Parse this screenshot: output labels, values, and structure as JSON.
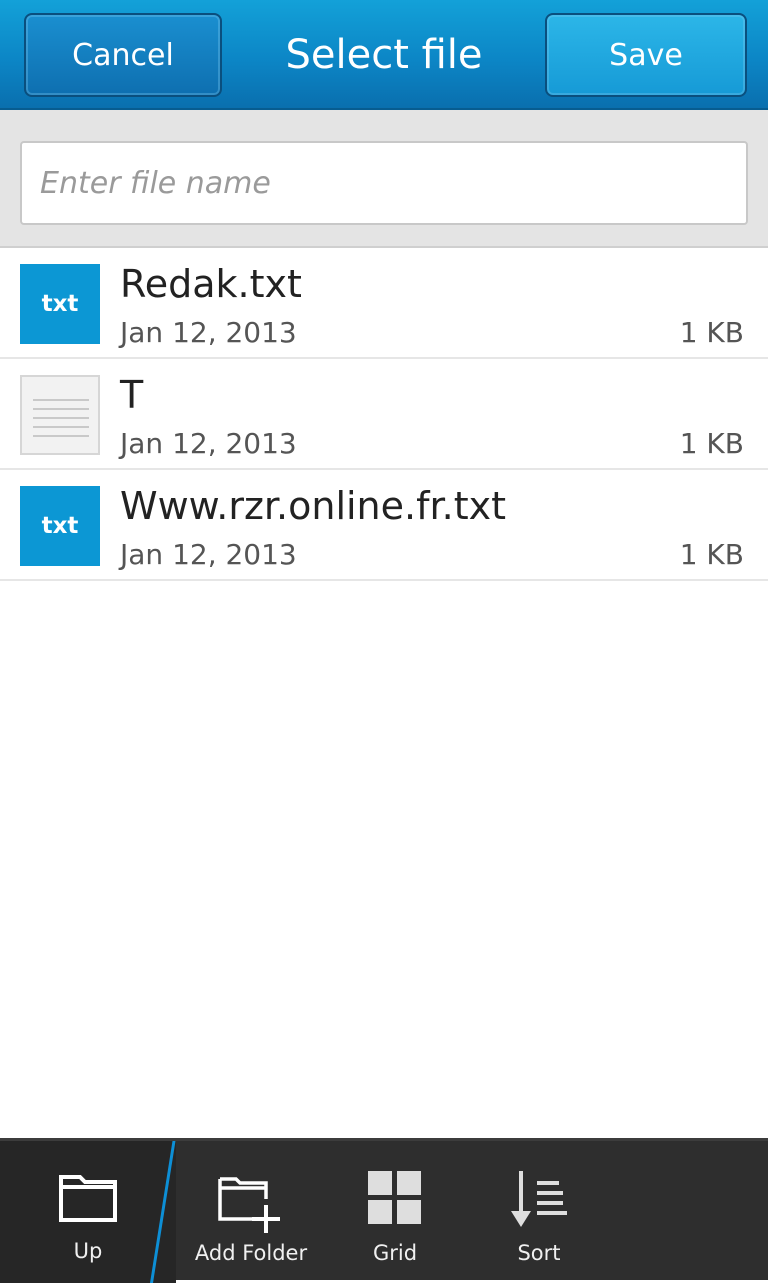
{
  "titlebar": {
    "cancel_label": "Cancel",
    "title": "Select file",
    "save_label": "Save"
  },
  "filename_field": {
    "placeholder": "Enter file name",
    "value": ""
  },
  "files": [
    {
      "name": "Redak.txt",
      "date": "Jan 12, 2013",
      "size": "1 KB",
      "thumb_type": "txt",
      "thumb_label": "txt"
    },
    {
      "name": "T",
      "date": "Jan 12, 2013",
      "size": "1 KB",
      "thumb_type": "doc",
      "thumb_label": ""
    },
    {
      "name": "Www.rzr.online.fr.txt",
      "date": "Jan 12, 2013",
      "size": "1 KB",
      "thumb_type": "txt",
      "thumb_label": "txt"
    }
  ],
  "actionbar": {
    "up_label": "Up",
    "add_folder_label": "Add Folder",
    "grid_label": "Grid",
    "sort_label": "Sort"
  },
  "icons": {
    "up": "folder-icon",
    "add_folder": "add-folder-icon",
    "grid": "grid-icon",
    "sort": "sort-icon"
  },
  "colors": {
    "accent": "#0c86c6",
    "txt_thumb": "#0c97d4",
    "actionbar": "#2e2e2e",
    "divider_accent": "#0d8fd6"
  }
}
